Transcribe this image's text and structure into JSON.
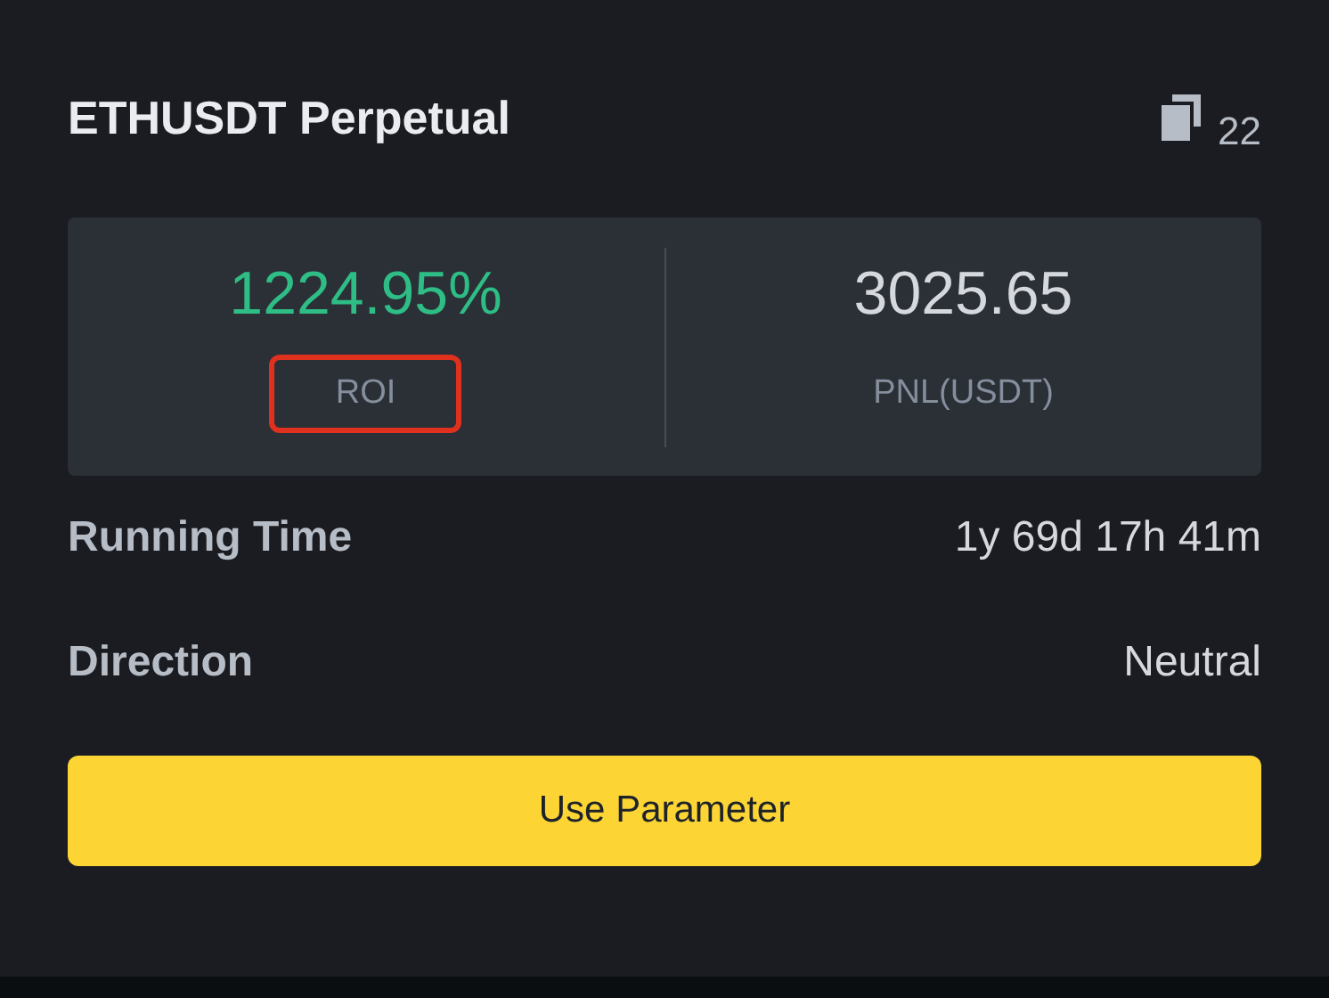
{
  "title": "ETHUSDT Perpetual",
  "copy_count": "22",
  "stats": [
    {
      "value": "1224.95%",
      "label": "ROI",
      "highlighted": true,
      "kind": "positive"
    },
    {
      "value": "3025.65",
      "label": "PNL(USDT)",
      "highlighted": false,
      "kind": "neutral"
    }
  ],
  "details": [
    {
      "label": "Running Time",
      "value": "1y 69d 17h 41m"
    },
    {
      "label": "Direction",
      "value": "Neutral"
    }
  ],
  "button": "Use Parameter"
}
